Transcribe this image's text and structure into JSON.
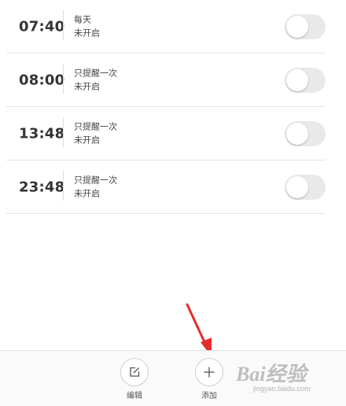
{
  "alarms": [
    {
      "time": "07:40",
      "repeat": "每天",
      "status": "未开启",
      "enabled": false
    },
    {
      "time": "08:00",
      "repeat": "只提醒一次",
      "status": "未开启",
      "enabled": false
    },
    {
      "time": "13:48",
      "repeat": "只提醒一次",
      "status": "未开启",
      "enabled": false
    },
    {
      "time": "23:48",
      "repeat": "只提醒一次",
      "status": "未开启",
      "enabled": false
    }
  ],
  "bottom_bar": {
    "edit_label": "编辑",
    "add_label": "添加"
  },
  "watermark": {
    "brand": "Bai经验",
    "url": "jingyan.baidu.com"
  },
  "colors": {
    "toggle_off": "#e9e9e9",
    "arrow": "#e52b2b"
  },
  "icons": {
    "edit": "edit-icon",
    "add": "plus-icon",
    "annotation": "red-arrow-annotation"
  }
}
